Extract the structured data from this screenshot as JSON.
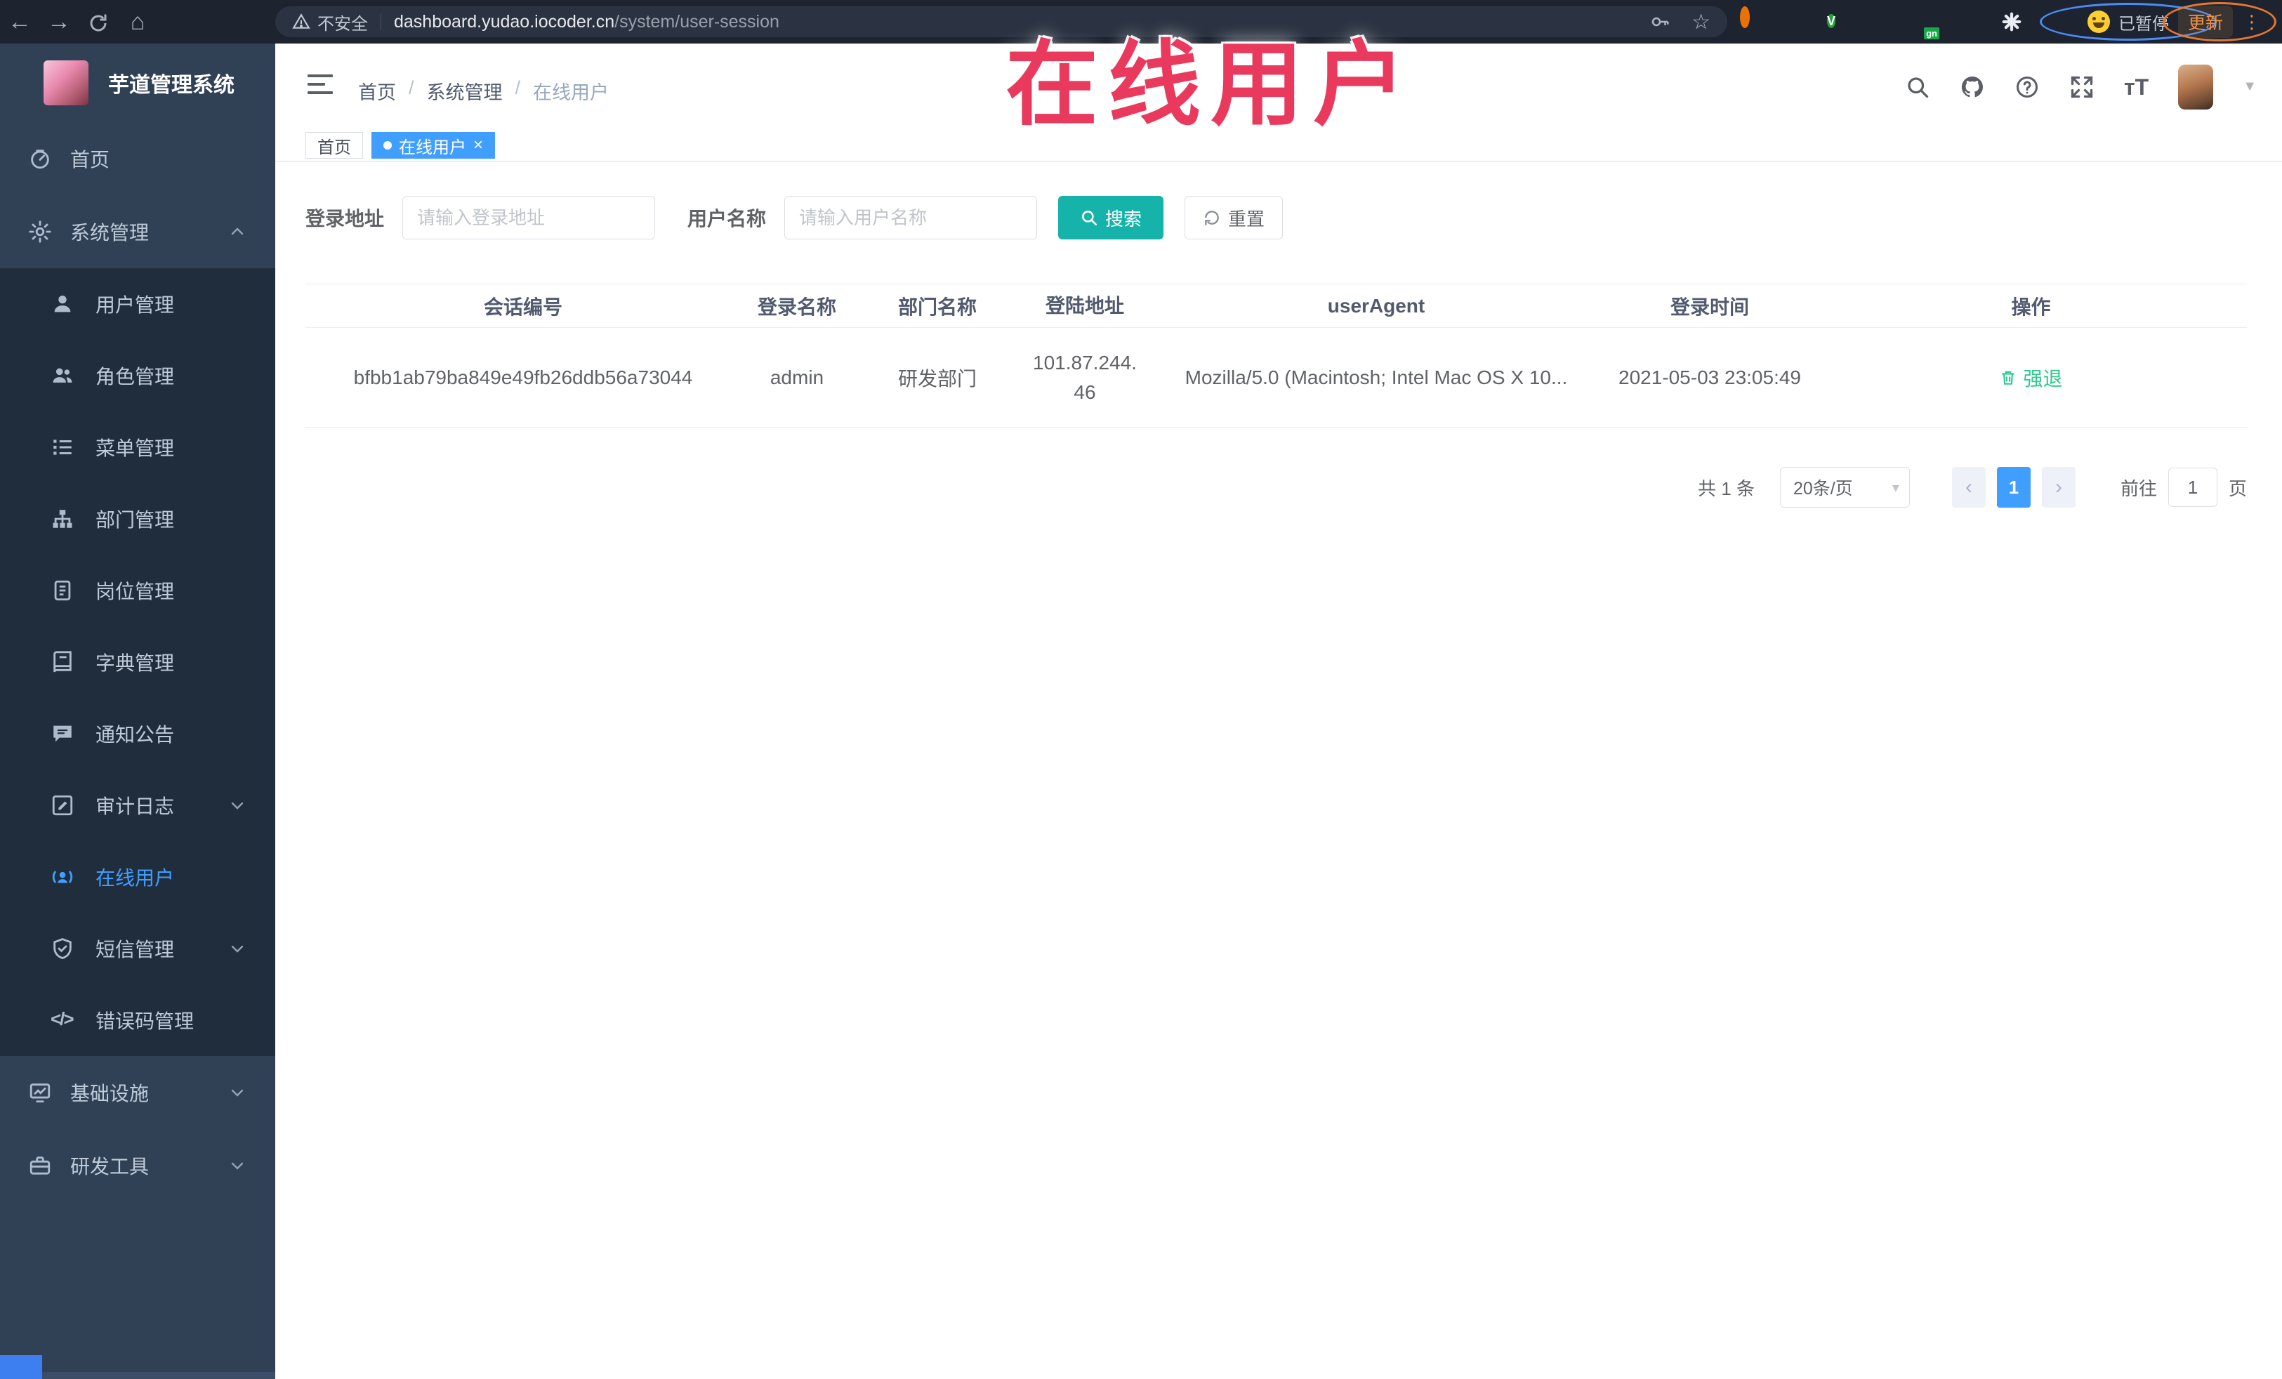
{
  "annotation": {
    "text": "在线用户",
    "color": "#e93a5e"
  },
  "browser": {
    "security_label": "不安全",
    "url_host": "dashboard.yudao.iocoder.cn",
    "url_path": "/system/user-session",
    "paused_label": "已暂停",
    "update_label": "更新"
  },
  "app_header": {
    "breadcrumb": [
      {
        "label": "首页"
      },
      {
        "label": "系统管理"
      },
      {
        "label": "在线用户"
      }
    ]
  },
  "tabs": [
    {
      "label": "首页"
    },
    {
      "label": "在线用户"
    }
  ],
  "sidebar": {
    "title": "芋道管理系统",
    "menu": [
      {
        "label": "首页",
        "icon": "dashboard-icon"
      },
      {
        "label": "系统管理",
        "icon": "gear-icon"
      },
      {
        "label": "用户管理",
        "icon": "user-icon"
      },
      {
        "label": "角色管理",
        "icon": "roles-icon"
      },
      {
        "label": "菜单管理",
        "icon": "menu-list-icon"
      },
      {
        "label": "部门管理",
        "icon": "dept-tree-icon"
      },
      {
        "label": "岗位管理",
        "icon": "post-badge-icon"
      },
      {
        "label": "字典管理",
        "icon": "dict-book-icon"
      },
      {
        "label": "通知公告",
        "icon": "notice-icon"
      },
      {
        "label": "审计日志",
        "icon": "audit-log-icon"
      },
      {
        "label": "在线用户",
        "icon": "online-users-icon"
      },
      {
        "label": "短信管理",
        "icon": "sms-shield-icon"
      },
      {
        "label": "错误码管理",
        "icon": "error-code-icon"
      },
      {
        "label": "基础设施",
        "icon": "infrastructure-icon"
      },
      {
        "label": "研发工具",
        "icon": "dev-tools-icon"
      }
    ]
  },
  "search_form": {
    "login_address_label": "登录地址",
    "login_address_placeholder": "请输入登录地址",
    "username_label": "用户名称",
    "username_placeholder": "请输入用户名称",
    "search_button": "搜索",
    "reset_button": "重置"
  },
  "table": {
    "columns": [
      "会话编号",
      "登录名称",
      "部门名称",
      "登陆地址",
      "userAgent",
      "登录时间",
      "操作"
    ],
    "rows": [
      {
        "session_id": "bfbb1ab79ba849e49fb26ddb56a73044",
        "username": "admin",
        "department": "研发部门",
        "login_ip": "101.87.244.46",
        "user_agent": "Mozilla/5.0 (Macintosh; Intel Mac OS X 10...",
        "login_time": "2021-05-03 23:05:49",
        "action": "强退"
      }
    ]
  },
  "pagination": {
    "total": "共 1 条",
    "page_size": "20条/页",
    "current_page": "1",
    "goto_label": "前往",
    "goto_value": "1",
    "page_unit": "页"
  },
  "colors": {
    "accent": "#409eff",
    "sidebar_bg": "#304156",
    "submenu_bg": "#1f2d3d",
    "search_button_teal": "#16b3aa",
    "action_green": "#2fc98f",
    "annotation_red": "#e93a5e"
  }
}
